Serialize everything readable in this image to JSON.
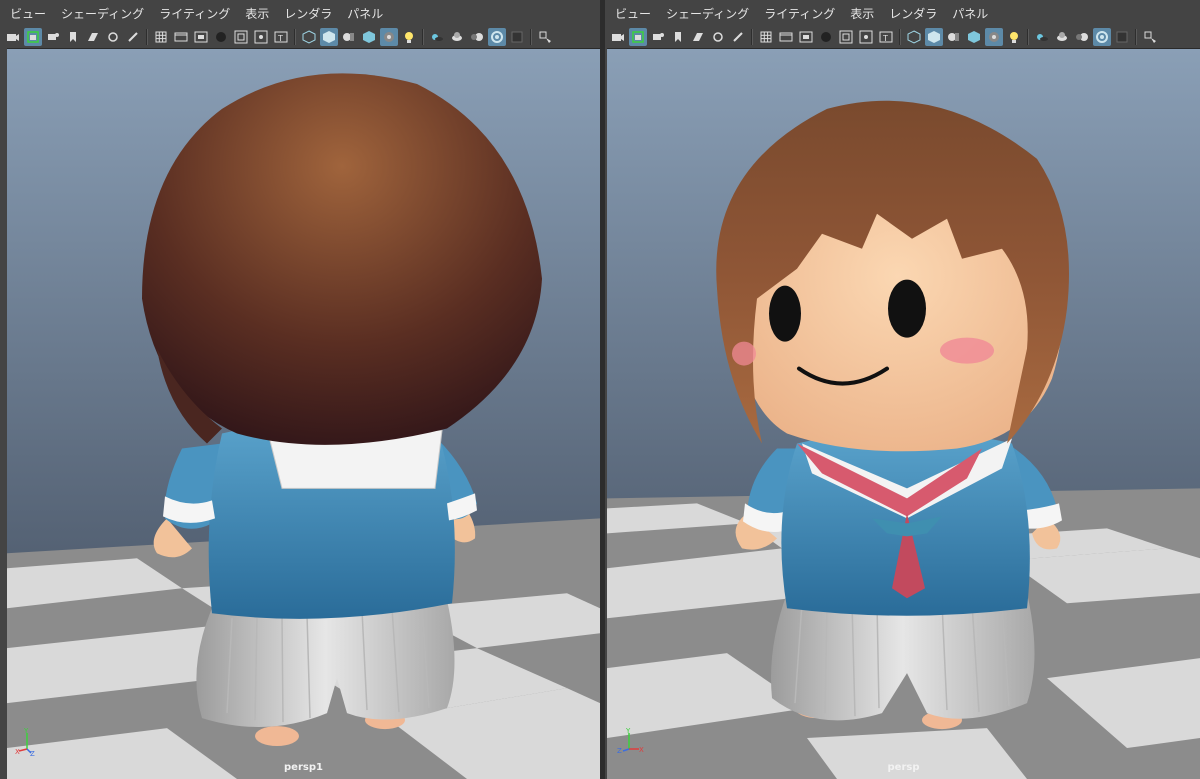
{
  "menus": {
    "left": [
      "ビュー",
      "シェーディング",
      "ライティング",
      "表示",
      "レンダラ",
      "パネル"
    ],
    "right": [
      "ビュー",
      "シェーディング",
      "ライティング",
      "表示",
      "レンダラ",
      "パネル"
    ]
  },
  "toolbar_icons": [
    "camera-icon",
    "select-camera-icon",
    "camera-attributes-icon",
    "bookmark-icon",
    "image-plane-icon",
    "2d-pan-zoom-icon",
    "grease-pencil-icon",
    "grid-icon",
    "film-gate-icon",
    "resolution-gate-icon",
    "gate-mask-icon",
    "field-chart-icon",
    "safe-action-icon",
    "safe-title-icon",
    "wireframe-icon",
    "smooth-shade-icon",
    "default-material-icon",
    "textured-icon",
    "xray-icon",
    "use-lights-icon",
    "shadows-icon",
    "ambient-occlusion-icon",
    "motion-blur-icon",
    "anti-aliasing-icon",
    "depth-of-field-icon",
    "isolate-select-icon"
  ],
  "viewports": {
    "left": {
      "camera": "persp1"
    },
    "right": {
      "camera": "persp"
    }
  },
  "axes": {
    "x": "X",
    "y": "Y",
    "z": "Z"
  },
  "colors": {
    "accent": "#5d8aa8",
    "bg_top": "#8a9fb6",
    "bg_bottom": "#3c4656",
    "hair": "#7a4a2e",
    "shirt": "#3f86b0",
    "skin": "#f2c29a",
    "scarf": "#d75a6e"
  }
}
